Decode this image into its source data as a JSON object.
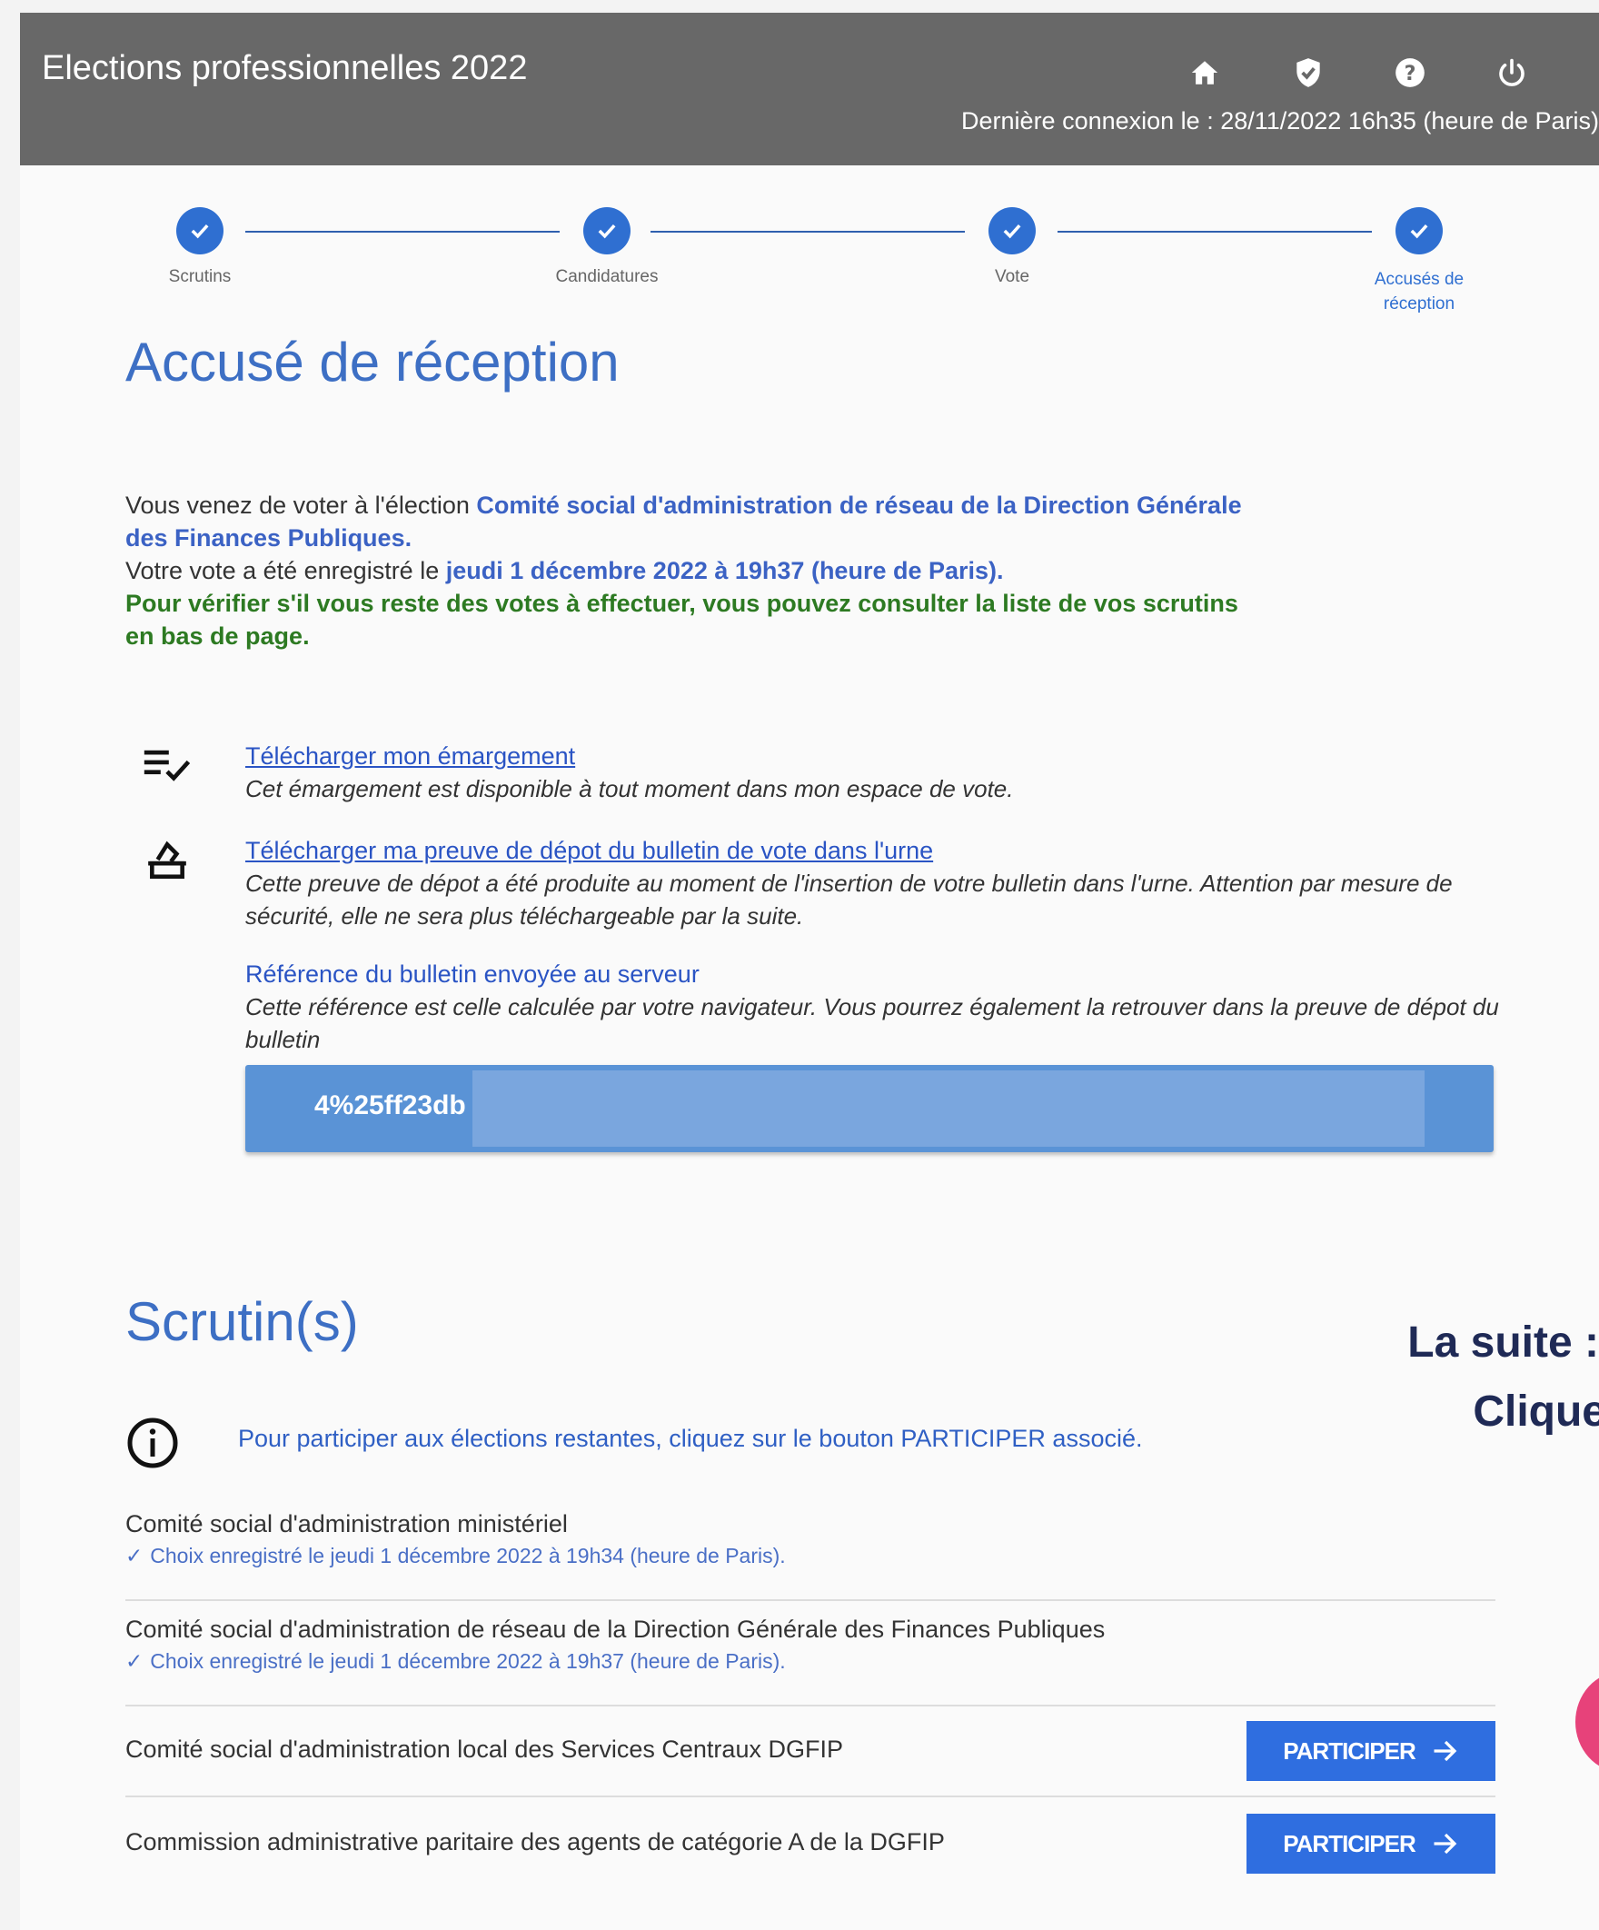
{
  "header": {
    "title": "Elections professionnelles 2022",
    "last_login": "Dernière connexion le : 28/11/2022 16h35 (heure de Paris)",
    "icons": [
      "home-icon",
      "shield-check-icon",
      "help-icon",
      "power-icon"
    ]
  },
  "stepper": {
    "steps": [
      {
        "label": "Scrutins",
        "done": true
      },
      {
        "label": "Candidatures",
        "done": true
      },
      {
        "label": "Vote",
        "done": true
      },
      {
        "label_line1": "Accusés de",
        "label_line2": "réception",
        "done": true,
        "active": true
      }
    ]
  },
  "receipt": {
    "title": "Accusé de réception",
    "intro_prefix": "Vous venez de voter à l'élection ",
    "election_name": "Comité social d'administration de réseau de la Direction Générale des Finances Publiques.",
    "vote_prefix": "Votre vote a été enregistré le ",
    "vote_date": "jeudi 1 décembre 2022 à 19h37 (heure de Paris).",
    "reminder": "Pour vérifier s'il vous reste des votes à effectuer, vous pouvez consulter la liste de vos scrutins en bas de page.",
    "download_signature_link": "Télécharger mon émargement",
    "download_signature_desc": "Cet émargement est disponible à tout moment dans mon espace de vote.",
    "download_proof_link": "Télécharger ma preuve de dépot du bulletin de vote dans l'urne",
    "download_proof_desc": "Cette preuve de dépot a été produite au moment de l'insertion de votre bulletin dans l'urne. Attention par mesure de sécurité, elle ne sera plus téléchargeable par la suite.",
    "reference_title": "Référence du bulletin envoyée au serveur",
    "reference_desc": "Cette référence est celle calculée par votre navigateur. Vous pourrez également la retrouver dans la preuve de dépot du bulletin",
    "reference_value": "4%25ff23db"
  },
  "ballots": {
    "title": "Scrutin(s)",
    "info": "Pour participer aux élections restantes, cliquez sur le bouton PARTICIPER associé.",
    "items": [
      {
        "name": "Comité social d'administration ministériel",
        "status": "Choix enregistré le jeudi 1 décembre 2022 à 19h34 (heure de Paris)."
      },
      {
        "name": "Comité social d'administration de réseau de la Direction Générale des Finances Publiques",
        "status": "Choix enregistré le jeudi 1 décembre 2022 à 19h37 (heure de Paris)."
      },
      {
        "name": "Comité social d'administration local des Services Centraux DGFIP",
        "button": "PARTICIPER"
      },
      {
        "name": "Commission administrative paritaire des agents de catégorie A de la DGFIP",
        "button": "PARTICIPER"
      }
    ]
  },
  "side_note": {
    "line1": "La suite :",
    "line2": "Clique"
  },
  "colors": {
    "header_bg": "#686868",
    "accent": "#2f6fd1",
    "title_blue": "#3d6fc4",
    "reminder_green": "#2d7a22",
    "side_note": "#1f2a56",
    "blob": "#e7427a"
  }
}
